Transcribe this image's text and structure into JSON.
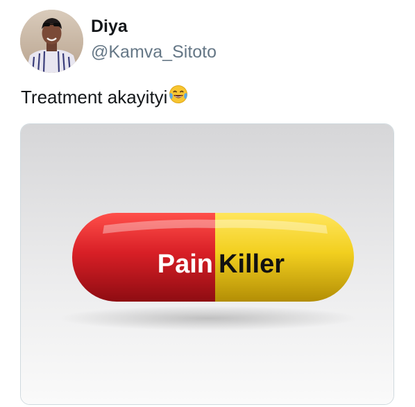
{
  "tweet": {
    "author": {
      "display_name": "Diya",
      "handle": "@Kamva_Sitoto"
    },
    "text": "Treatment akayityi",
    "emoji": "face-with-tears-of-joy-icon",
    "media": {
      "pill_text_left": "Pain",
      "pill_text_right": "Killer",
      "colors": {
        "pill_left": "#d81f26",
        "pill_right": "#f2cf1f",
        "text_left": "#ffffff",
        "text_right": "#111111"
      }
    }
  }
}
